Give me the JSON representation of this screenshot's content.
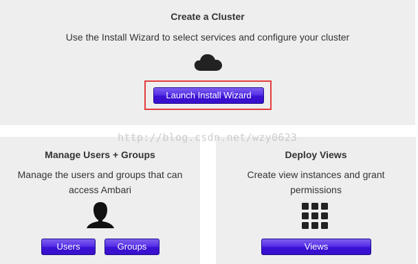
{
  "create_cluster": {
    "title": "Create a Cluster",
    "description": "Use the Install Wizard to select services and configure your cluster",
    "icon": "cloud-icon",
    "launch_button_label": "Launch Install Wizard"
  },
  "manage_users": {
    "title": "Manage Users + Groups",
    "description": "Manage the users and groups that can access Ambari",
    "icon": "user-icon",
    "users_button_label": "Users",
    "groups_button_label": "Groups"
  },
  "deploy_views": {
    "title": "Deploy Views",
    "description": "Create view instances and grant permissions",
    "icon": "grid-icon",
    "views_button_label": "Views"
  },
  "watermark": "http://blog.csdn.net/wzy0623",
  "colors": {
    "panel_background": "#eeeeee",
    "button_primary": "#3a0fcc",
    "highlight_border": "#e53a3a"
  }
}
